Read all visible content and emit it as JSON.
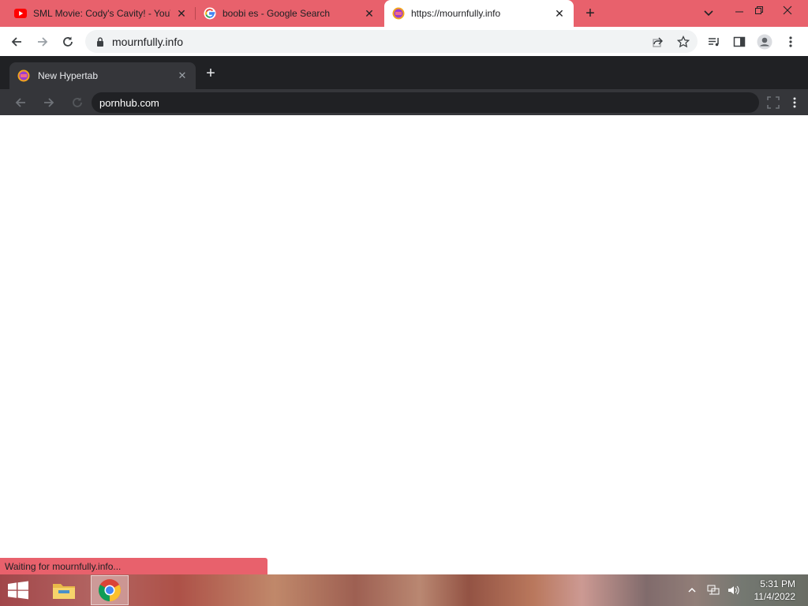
{
  "browser": {
    "tabs": [
      {
        "title": "SML Movie: Cody's Cavity! - YouT",
        "icon": "youtube-icon"
      },
      {
        "title": "boobi es - Google Search",
        "icon": "google-icon"
      },
      {
        "title": "https://mournfully.info",
        "icon": "hypertab-icon",
        "active": true
      }
    ],
    "address": "mournfully.info",
    "status_text": "Waiting for mournfully.info..."
  },
  "inner_browser": {
    "tab_title": "New Hypertab",
    "address": "pornhub.com"
  },
  "taskbar": {
    "apps": [
      {
        "name": "File Explorer",
        "icon": "file-explorer-icon"
      },
      {
        "name": "Google Chrome",
        "icon": "chrome-icon",
        "active": true
      }
    ],
    "time": "5:31 PM",
    "date": "11/4/2022"
  },
  "colors": {
    "tabstrip": "#e8616c",
    "inner_dark": "#202124",
    "inner_toolbar": "#35363a"
  }
}
